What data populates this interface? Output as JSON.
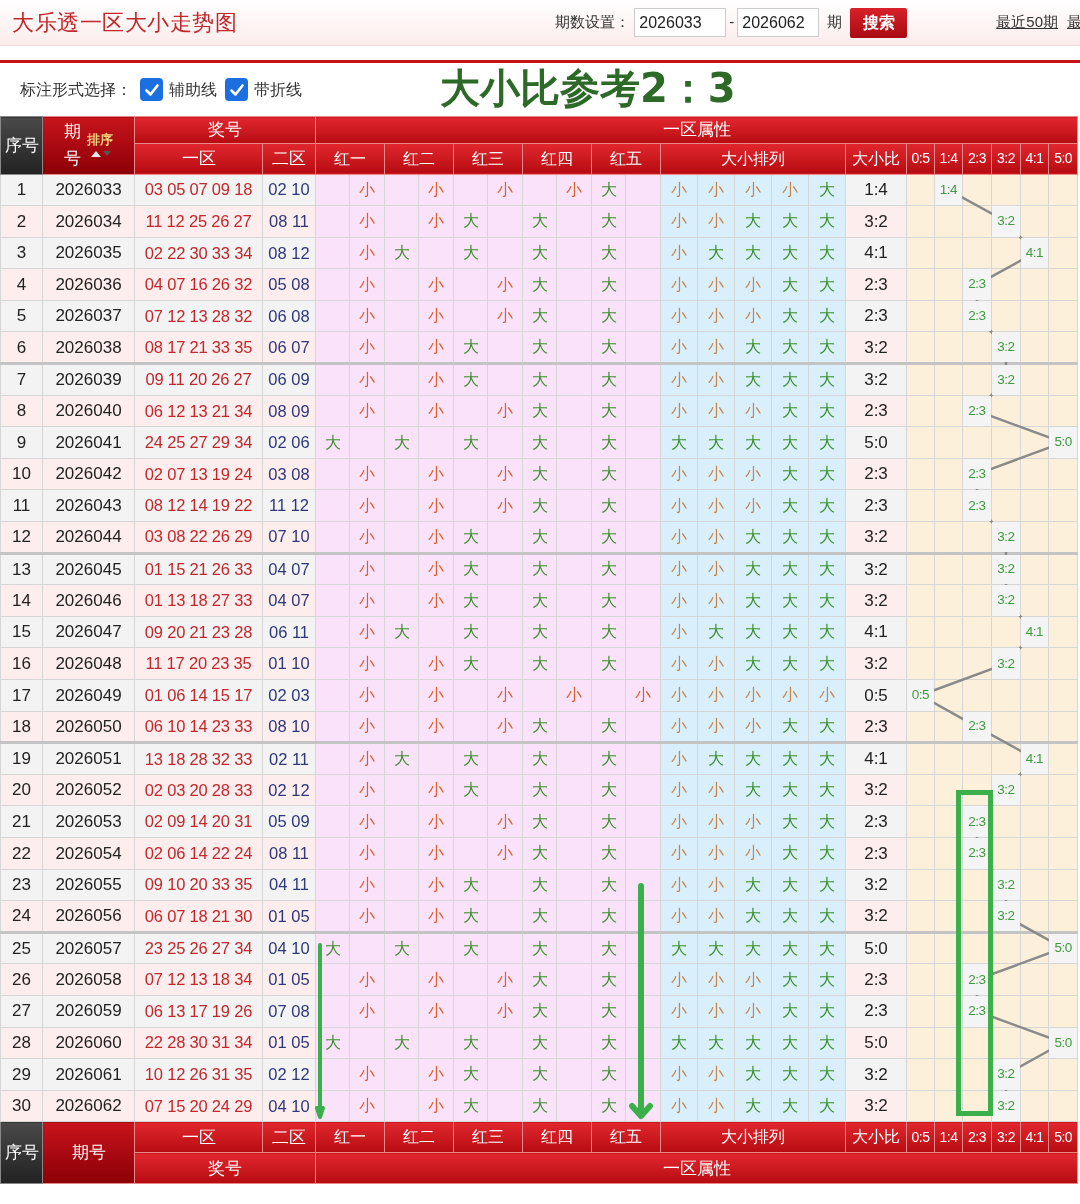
{
  "header": {
    "title": "大乐透一区大小走势图",
    "range_label": "期数设置：",
    "from": "2026033",
    "dash": "-",
    "to": "2026062",
    "unit": "期",
    "search_button": "搜索",
    "links": [
      "最近50期",
      "最"
    ]
  },
  "options": {
    "label": "标注形式选择：",
    "items": [
      {
        "label": "辅助线",
        "checked": true
      },
      {
        "label": "带折线",
        "checked": true
      }
    ]
  },
  "table": {
    "head": {
      "seq": "序号",
      "period": "期号",
      "sort": "排序",
      "numbers": "奖号",
      "attributes": "一区属性",
      "front": "一区",
      "back": "二区",
      "balls": [
        "红一",
        "红二",
        "红三",
        "红四",
        "红五"
      ],
      "arrangement": "大小排列",
      "ratio": "大小比",
      "trend": [
        "0:5",
        "1:4",
        "2:3",
        "3:2",
        "4:1",
        "5:0"
      ]
    },
    "rows": [
      {
        "seq": "1",
        "period": "2026033",
        "front": "03 05 07 09 18",
        "back": "02 10",
        "attr": [
          "小",
          "小",
          "小",
          "小",
          "大"
        ],
        "big": [
          false,
          false,
          false,
          false,
          true
        ],
        "arrangement": [
          "小",
          "小",
          "小",
          "小",
          "大"
        ],
        "ratio": "1:4",
        "trend": [
          false,
          true,
          false,
          false,
          false,
          false
        ],
        "trend_label": "1:4"
      },
      {
        "seq": "2",
        "period": "2026034",
        "front": "11 12 25 26 27",
        "back": "08 11",
        "attr": [
          "小",
          "小",
          "大",
          "大",
          "大"
        ],
        "big": [
          false,
          false,
          true,
          true,
          true
        ],
        "arrangement": [
          "小",
          "小",
          "大",
          "大",
          "大"
        ],
        "ratio": "3:2",
        "trend": [
          false,
          false,
          false,
          true,
          false,
          false
        ],
        "trend_label": "3:2"
      },
      {
        "seq": "3",
        "period": "2026035",
        "front": "02 22 30 33 34",
        "back": "08 12",
        "attr": [
          "小",
          "大",
          "大",
          "大",
          "大"
        ],
        "big": [
          false,
          true,
          true,
          true,
          true
        ],
        "arrangement": [
          "小",
          "大",
          "大",
          "大",
          "大"
        ],
        "ratio": "4:1",
        "trend": [
          false,
          false,
          false,
          false,
          true,
          false
        ],
        "trend_label": "4:1"
      },
      {
        "seq": "4",
        "period": "2026036",
        "front": "04 07 16 26 32",
        "back": "05 08",
        "attr": [
          "小",
          "小",
          "小",
          "大",
          "大"
        ],
        "big": [
          false,
          false,
          false,
          true,
          true
        ],
        "arrangement": [
          "小",
          "小",
          "小",
          "大",
          "大"
        ],
        "ratio": "2:3",
        "trend": [
          false,
          false,
          true,
          false,
          false,
          false
        ],
        "trend_label": "2:3"
      },
      {
        "seq": "5",
        "period": "2026037",
        "front": "07 12 13 28 32",
        "back": "06 08",
        "attr": [
          "小",
          "小",
          "小",
          "大",
          "大"
        ],
        "big": [
          false,
          false,
          false,
          true,
          true
        ],
        "arrangement": [
          "小",
          "小",
          "小",
          "大",
          "大"
        ],
        "ratio": "2:3",
        "trend": [
          false,
          false,
          true,
          false,
          false,
          false
        ],
        "trend_label": "2:3"
      },
      {
        "seq": "6",
        "period": "2026038",
        "front": "08 17 21 33 35",
        "back": "06 07",
        "attr": [
          "小",
          "小",
          "大",
          "大",
          "大"
        ],
        "big": [
          false,
          false,
          true,
          true,
          true
        ],
        "arrangement": [
          "小",
          "小",
          "大",
          "大",
          "大"
        ],
        "ratio": "3:2",
        "trend": [
          false,
          false,
          false,
          true,
          false,
          false
        ],
        "trend_label": "3:2"
      },
      {
        "seq": "7",
        "period": "2026039",
        "front": "09 11 20 26 27",
        "back": "06 09",
        "attr": [
          "小",
          "小",
          "大",
          "大",
          "大"
        ],
        "big": [
          false,
          false,
          true,
          true,
          true
        ],
        "arrangement": [
          "小",
          "小",
          "大",
          "大",
          "大"
        ],
        "ratio": "3:2",
        "trend": [
          false,
          false,
          false,
          true,
          false,
          false
        ],
        "trend_label": "3:2"
      },
      {
        "seq": "8",
        "period": "2026040",
        "front": "06 12 13 21 34",
        "back": "08 09",
        "attr": [
          "小",
          "小",
          "小",
          "大",
          "大"
        ],
        "big": [
          false,
          false,
          false,
          true,
          true
        ],
        "arrangement": [
          "小",
          "小",
          "小",
          "大",
          "大"
        ],
        "ratio": "2:3",
        "trend": [
          false,
          false,
          true,
          false,
          false,
          false
        ],
        "trend_label": "2:3"
      },
      {
        "seq": "9",
        "period": "2026041",
        "front": "24 25 27 29 34",
        "back": "02 06",
        "attr": [
          "大",
          "大",
          "大",
          "大",
          "大"
        ],
        "big": [
          true,
          true,
          true,
          true,
          true
        ],
        "arrangement": [
          "大",
          "大",
          "大",
          "大",
          "大"
        ],
        "ratio": "5:0",
        "trend": [
          false,
          false,
          false,
          false,
          false,
          true
        ],
        "trend_label": "5:0"
      },
      {
        "seq": "10",
        "period": "2026042",
        "front": "02 07 13 19 24",
        "back": "03 08",
        "attr": [
          "小",
          "小",
          "小",
          "大",
          "大"
        ],
        "big": [
          false,
          false,
          false,
          true,
          true
        ],
        "arrangement": [
          "小",
          "小",
          "小",
          "大",
          "大"
        ],
        "ratio": "2:3",
        "trend": [
          false,
          false,
          true,
          false,
          false,
          false
        ],
        "trend_label": "2:3"
      },
      {
        "seq": "11",
        "period": "2026043",
        "front": "08 12 14 19 22",
        "back": "11 12",
        "attr": [
          "小",
          "小",
          "小",
          "大",
          "大"
        ],
        "big": [
          false,
          false,
          false,
          true,
          true
        ],
        "arrangement": [
          "小",
          "小",
          "小",
          "大",
          "大"
        ],
        "ratio": "2:3",
        "trend": [
          false,
          false,
          true,
          false,
          false,
          false
        ],
        "trend_label": "2:3"
      },
      {
        "seq": "12",
        "period": "2026044",
        "front": "03 08 22 26 29",
        "back": "07 10",
        "attr": [
          "小",
          "小",
          "大",
          "大",
          "大"
        ],
        "big": [
          false,
          false,
          true,
          true,
          true
        ],
        "arrangement": [
          "小",
          "小",
          "大",
          "大",
          "大"
        ],
        "ratio": "3:2",
        "trend": [
          false,
          false,
          false,
          true,
          false,
          false
        ],
        "trend_label": "3:2"
      },
      {
        "seq": "13",
        "period": "2026045",
        "front": "01 15 21 26 33",
        "back": "04 07",
        "attr": [
          "小",
          "小",
          "大",
          "大",
          "大"
        ],
        "big": [
          false,
          false,
          true,
          true,
          true
        ],
        "arrangement": [
          "小",
          "小",
          "大",
          "大",
          "大"
        ],
        "ratio": "3:2",
        "trend": [
          false,
          false,
          false,
          true,
          false,
          false
        ],
        "trend_label": "3:2"
      },
      {
        "seq": "14",
        "period": "2026046",
        "front": "01 13 18 27 33",
        "back": "04 07",
        "attr": [
          "小",
          "小",
          "大",
          "大",
          "大"
        ],
        "big": [
          false,
          false,
          true,
          true,
          true
        ],
        "arrangement": [
          "小",
          "小",
          "大",
          "大",
          "大"
        ],
        "ratio": "3:2",
        "trend": [
          false,
          false,
          false,
          true,
          false,
          false
        ],
        "trend_label": "3:2"
      },
      {
        "seq": "15",
        "period": "2026047",
        "front": "09 20 21 23 28",
        "back": "06 11",
        "attr": [
          "小",
          "大",
          "大",
          "大",
          "大"
        ],
        "big": [
          false,
          true,
          true,
          true,
          true
        ],
        "arrangement": [
          "小",
          "大",
          "大",
          "大",
          "大"
        ],
        "ratio": "4:1",
        "trend": [
          false,
          false,
          false,
          false,
          true,
          false
        ],
        "trend_label": "4:1"
      },
      {
        "seq": "16",
        "period": "2026048",
        "front": "11 17 20 23 35",
        "back": "01 10",
        "attr": [
          "小",
          "小",
          "大",
          "大",
          "大"
        ],
        "big": [
          false,
          false,
          true,
          true,
          true
        ],
        "arrangement": [
          "小",
          "小",
          "大",
          "大",
          "大"
        ],
        "ratio": "3:2",
        "trend": [
          false,
          false,
          false,
          true,
          false,
          false
        ],
        "trend_label": "3:2"
      },
      {
        "seq": "17",
        "period": "2026049",
        "front": "01 06 14 15 17",
        "back": "02 03",
        "attr": [
          "小",
          "小",
          "小",
          "小",
          "小"
        ],
        "big": [
          false,
          false,
          false,
          false,
          false
        ],
        "arrangement": [
          "小",
          "小",
          "小",
          "小",
          "小"
        ],
        "ratio": "0:5",
        "trend": [
          true,
          false,
          false,
          false,
          false,
          false
        ],
        "trend_label": "0:5"
      },
      {
        "seq": "18",
        "period": "2026050",
        "front": "06 10 14 23 33",
        "back": "08 10",
        "attr": [
          "小",
          "小",
          "小",
          "大",
          "大"
        ],
        "big": [
          false,
          false,
          false,
          true,
          true
        ],
        "arrangement": [
          "小",
          "小",
          "小",
          "大",
          "大"
        ],
        "ratio": "2:3",
        "trend": [
          false,
          false,
          true,
          false,
          false,
          false
        ],
        "trend_label": "2:3"
      },
      {
        "seq": "19",
        "period": "2026051",
        "front": "13 18 28 32 33",
        "back": "02 11",
        "attr": [
          "小",
          "大",
          "大",
          "大",
          "大"
        ],
        "big": [
          false,
          true,
          true,
          true,
          true
        ],
        "arrangement": [
          "小",
          "大",
          "大",
          "大",
          "大"
        ],
        "ratio": "4:1",
        "trend": [
          false,
          false,
          false,
          false,
          true,
          false
        ],
        "trend_label": "4:1"
      },
      {
        "seq": "20",
        "period": "2026052",
        "front": "02 03 20 28 33",
        "back": "02 12",
        "attr": [
          "小",
          "小",
          "大",
          "大",
          "大"
        ],
        "big": [
          false,
          false,
          true,
          true,
          true
        ],
        "arrangement": [
          "小",
          "小",
          "大",
          "大",
          "大"
        ],
        "ratio": "3:2",
        "trend": [
          false,
          false,
          false,
          true,
          false,
          false
        ],
        "trend_label": "3:2"
      },
      {
        "seq": "21",
        "period": "2026053",
        "front": "02 09 14 20 31",
        "back": "05 09",
        "attr": [
          "小",
          "小",
          "小",
          "大",
          "大"
        ],
        "big": [
          false,
          false,
          false,
          true,
          true
        ],
        "arrangement": [
          "小",
          "小",
          "小",
          "大",
          "大"
        ],
        "ratio": "2:3",
        "trend": [
          false,
          false,
          true,
          false,
          false,
          false
        ],
        "trend_label": "2:3"
      },
      {
        "seq": "22",
        "period": "2026054",
        "front": "02 06 14 22 24",
        "back": "08 11",
        "attr": [
          "小",
          "小",
          "小",
          "大",
          "大"
        ],
        "big": [
          false,
          false,
          false,
          true,
          true
        ],
        "arrangement": [
          "小",
          "小",
          "小",
          "大",
          "大"
        ],
        "ratio": "2:3",
        "trend": [
          false,
          false,
          true,
          false,
          false,
          false
        ],
        "trend_label": "2:3"
      },
      {
        "seq": "23",
        "period": "2026055",
        "front": "09 10 20 33 35",
        "back": "04 11",
        "attr": [
          "小",
          "小",
          "大",
          "大",
          "大"
        ],
        "big": [
          false,
          false,
          true,
          true,
          true
        ],
        "arrangement": [
          "小",
          "小",
          "大",
          "大",
          "大"
        ],
        "ratio": "3:2",
        "trend": [
          false,
          false,
          false,
          true,
          false,
          false
        ],
        "trend_label": "3:2"
      },
      {
        "seq": "24",
        "period": "2026056",
        "front": "06 07 18 21 30",
        "back": "01 05",
        "attr": [
          "小",
          "小",
          "大",
          "大",
          "大"
        ],
        "big": [
          false,
          false,
          true,
          true,
          true
        ],
        "arrangement": [
          "小",
          "小",
          "大",
          "大",
          "大"
        ],
        "ratio": "3:2",
        "trend": [
          false,
          false,
          false,
          true,
          false,
          false
        ],
        "trend_label": "3:2"
      },
      {
        "seq": "25",
        "period": "2026057",
        "front": "23 25 26 27 34",
        "back": "04 10",
        "attr": [
          "大",
          "大",
          "大",
          "大",
          "大"
        ],
        "big": [
          true,
          true,
          true,
          true,
          true
        ],
        "arrangement": [
          "大",
          "大",
          "大",
          "大",
          "大"
        ],
        "ratio": "5:0",
        "trend": [
          false,
          false,
          false,
          false,
          false,
          true
        ],
        "trend_label": "5:0"
      },
      {
        "seq": "26",
        "period": "2026058",
        "front": "07 12 13 18 34",
        "back": "01 05",
        "attr": [
          "小",
          "小",
          "小",
          "大",
          "大"
        ],
        "big": [
          false,
          false,
          false,
          true,
          true
        ],
        "arrangement": [
          "小",
          "小",
          "小",
          "大",
          "大"
        ],
        "ratio": "2:3",
        "trend": [
          false,
          false,
          true,
          false,
          false,
          false
        ],
        "trend_label": "2:3"
      },
      {
        "seq": "27",
        "period": "2026059",
        "front": "06 13 17 19 26",
        "back": "07 08",
        "attr": [
          "小",
          "小",
          "小",
          "大",
          "大"
        ],
        "big": [
          false,
          false,
          false,
          true,
          true
        ],
        "arrangement": [
          "小",
          "小",
          "小",
          "大",
          "大"
        ],
        "ratio": "2:3",
        "trend": [
          false,
          false,
          true,
          false,
          false,
          false
        ],
        "trend_label": "2:3"
      },
      {
        "seq": "28",
        "period": "2026060",
        "front": "22 28 30 31 34",
        "back": "01 05",
        "attr": [
          "大",
          "大",
          "大",
          "大",
          "大"
        ],
        "big": [
          true,
          true,
          true,
          true,
          true
        ],
        "arrangement": [
          "大",
          "大",
          "大",
          "大",
          "大"
        ],
        "ratio": "5:0",
        "trend": [
          false,
          false,
          false,
          false,
          false,
          true
        ],
        "trend_label": "5:0"
      },
      {
        "seq": "29",
        "period": "2026061",
        "front": "10 12 26 31 35",
        "back": "02 12",
        "attr": [
          "小",
          "小",
          "大",
          "大",
          "大"
        ],
        "big": [
          false,
          false,
          true,
          true,
          true
        ],
        "arrangement": [
          "小",
          "小",
          "大",
          "大",
          "大"
        ],
        "ratio": "3:2",
        "trend": [
          false,
          false,
          false,
          true,
          false,
          false
        ],
        "trend_label": "3:2"
      },
      {
        "seq": "30",
        "period": "2026062",
        "front": "07 15 20 24 29",
        "back": "04 10",
        "attr": [
          "小",
          "小",
          "大",
          "大",
          "大"
        ],
        "big": [
          false,
          false,
          true,
          true,
          true
        ],
        "arrangement": [
          "小",
          "小",
          "大",
          "大",
          "大"
        ],
        "ratio": "3:2",
        "trend": [
          false,
          false,
          false,
          true,
          false,
          false
        ],
        "trend_label": "3:2"
      }
    ],
    "foot": {
      "seq": "序号",
      "period": "期号",
      "front": "一区",
      "back": "二区",
      "balls": [
        "红一",
        "红二",
        "红三",
        "红四",
        "红五"
      ],
      "arrangement": "大小排列",
      "ratio": "大小比",
      "trend": [
        "0:5",
        "1:4",
        "2:3",
        "3:2",
        "4:1",
        "5:0"
      ],
      "numbers": "奖号",
      "attributes": "一区属性"
    }
  },
  "annotation": {
    "text": "大小比参考2：3"
  }
}
